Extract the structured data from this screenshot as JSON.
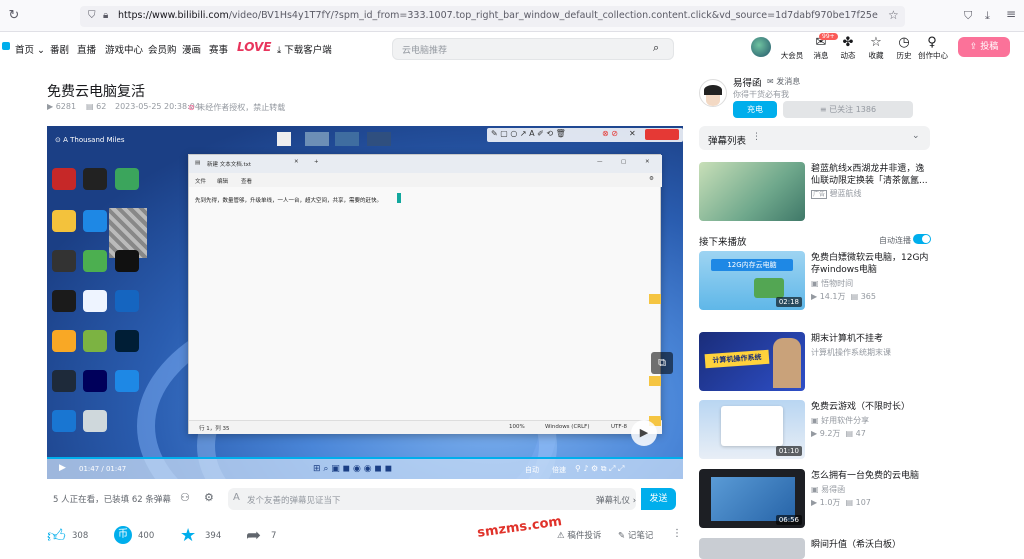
{
  "browser": {
    "url_host": "https://www.bilibili.com",
    "url_path": "/video/BV1Hs4y1T7fY/?spm_id_from=333.1007.top_right_bar_window_default_collection.content.click&vd_source=1d7dabf970be17f25e1e6f9d845b99aa"
  },
  "header": {
    "nav": [
      "首页",
      "番剧",
      "直播",
      "游戏中心",
      "会员购",
      "漫画",
      "赛事",
      "LOVE",
      "下载客户端"
    ],
    "search_placeholder": "云电脑推荐",
    "right_items": [
      {
        "label": "大会员",
        "icon": "vip-avatar-icon"
      },
      {
        "label": "消息",
        "icon": "message-icon",
        "badge": "99+"
      },
      {
        "label": "动态",
        "icon": "dynamic-icon"
      },
      {
        "label": "收藏",
        "icon": "star-icon"
      },
      {
        "label": "历史",
        "icon": "clock-icon"
      },
      {
        "label": "创作中心",
        "icon": "bulb-icon"
      }
    ],
    "upload_label": "投稿"
  },
  "video": {
    "title": "免费云电脑复活",
    "views": "6281",
    "danmaku": "62",
    "date": "2023-05-25 20:38:04",
    "copyright": "未经作者授权，禁止转载",
    "time": "01:47 / 01:47",
    "watching": "5 人正在看，已装填 62 条弹幕",
    "danmu_placeholder": "发个友善的弹幕见证当下",
    "danmu_etiquette": "弹幕礼仪",
    "send_label": "发送",
    "likes": "308",
    "coins": "400",
    "favorites": "394",
    "shares": "7",
    "report_label": "稿件投诉",
    "notes_label": "记笔记",
    "player_ctrl": [
      "自动",
      "倍速"
    ],
    "notepad_text": "先到先得，数量管够，升级单线，一人一台，超大空间，共享，需要的赶快。",
    "notepad_title": "新建 文本文档.txt",
    "notepad_menu": [
      "文件",
      "编辑",
      "查看"
    ],
    "notepad_status": [
      "行 1，列 35",
      "100%",
      "Windows (CRLF)",
      "UTF-8"
    ],
    "desktop_video_title": "A Thousand Miles"
  },
  "uploader": {
    "name": "易得函",
    "message_label": "发消息",
    "desc": "你得干货必有我",
    "charge_label": "充电",
    "follow_label": "已关注 1386"
  },
  "danmu_list_label": "弹幕列表",
  "ad": {
    "title": "碧蓝航线x西湖龙井非遗，逸仙联动限定换装「清茶氤氲...",
    "author": "碧蓝航线"
  },
  "next_up_label": "接下来播放",
  "autoplay_label": "自动连播",
  "recommendations": [
    {
      "title": "免费白嫖微软云电脑，12G内存windows电脑",
      "author": "悟物时间",
      "plays": "14.1万",
      "danmaku": "365",
      "duration": "02:18",
      "thumb_text": "12G内存云电脑"
    },
    {
      "title": "期末计算机不挂考",
      "author": "计算机操作系统期末课",
      "plays": "",
      "danmaku": "",
      "duration": "",
      "thumb_text": "计算机操作系统"
    },
    {
      "title": "免费云游戏（不限时长）",
      "author": "好用软件分享",
      "plays": "9.2万",
      "danmaku": "47",
      "duration": "01:10",
      "thumb_text": ""
    },
    {
      "title": "怎么拥有一台免费的云电脑",
      "author": "易得函",
      "plays": "1.0万",
      "danmaku": "107",
      "duration": "06:56",
      "thumb_text": ""
    },
    {
      "title": "瞬间升值（希沃白板）",
      "author": "",
      "plays": "",
      "danmaku": "",
      "duration": "",
      "thumb_text": ""
    }
  ],
  "watermark": "smzms.com"
}
